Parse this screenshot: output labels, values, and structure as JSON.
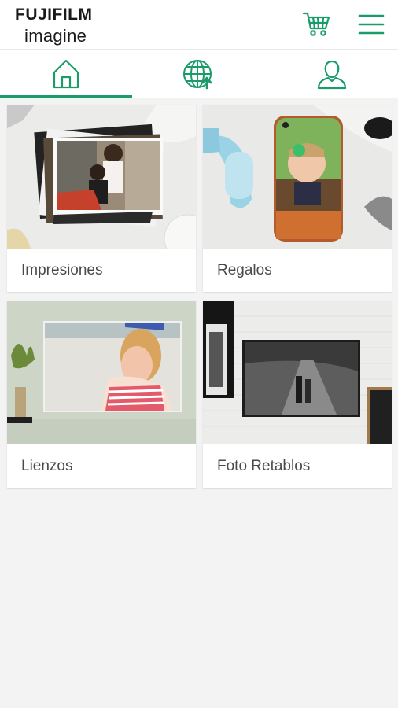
{
  "header": {
    "logo_line1": "FUJIFILM",
    "logo_line2": "imagine",
    "cart_icon": "shopping-cart-icon",
    "menu_icon": "hamburger-menu-icon"
  },
  "tabs": [
    {
      "name": "home",
      "icon": "home-icon",
      "active": true
    },
    {
      "name": "globe",
      "icon": "globe-upload-icon",
      "active": false
    },
    {
      "name": "profile",
      "icon": "user-icon",
      "active": false
    }
  ],
  "categories": [
    {
      "label": "Impresiones"
    },
    {
      "label": "Regalos"
    },
    {
      "label": "Lienzos"
    },
    {
      "label": "Foto Retablos"
    }
  ],
  "colors": {
    "accent": "#1a9c6a",
    "background": "#f3f3f3",
    "card": "#ffffff",
    "label_text": "#4a4a4a"
  }
}
